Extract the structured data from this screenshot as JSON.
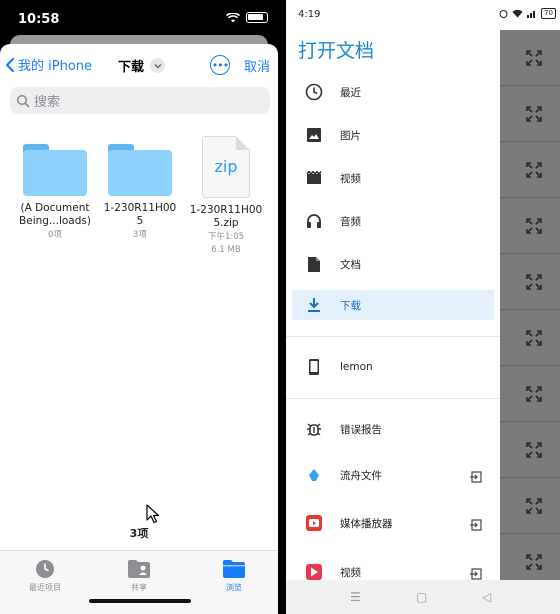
{
  "ios": {
    "status_time": "10:58",
    "nav": {
      "back_label": "我的 iPhone",
      "title": "下载",
      "cancel_label": "取消"
    },
    "search_placeholder": "搜索",
    "files": [
      {
        "type": "folder",
        "name_line1": "(A Document",
        "name_line2": "Being...loads)",
        "meta1": "0项",
        "meta2": ""
      },
      {
        "type": "folder",
        "name_line1": "1-230R11H00",
        "name_line2": "5",
        "meta1": "3项",
        "meta2": ""
      },
      {
        "type": "zip",
        "icon_text": "zip",
        "name_line1": "1-230R11H00",
        "name_line2": "5.zip",
        "meta1": "下午1:05",
        "meta2": "6.1 MB"
      }
    ],
    "item_count": "3项",
    "tabs": [
      {
        "label": "最近项目",
        "icon": "clock-icon"
      },
      {
        "label": "共享",
        "icon": "shared-folder-icon"
      },
      {
        "label": "浏览",
        "icon": "folder-icon"
      }
    ]
  },
  "android": {
    "status_time": "4:19",
    "battery": "70",
    "drawer_title": "打开文档",
    "items": [
      {
        "label": "最近",
        "icon": "clock-icon"
      },
      {
        "label": "图片",
        "icon": "image-icon"
      },
      {
        "label": "视频",
        "icon": "movie-icon"
      },
      {
        "label": "音频",
        "icon": "headphones-icon"
      },
      {
        "label": "文档",
        "icon": "document-icon"
      },
      {
        "label": "下载",
        "icon": "download-icon"
      }
    ],
    "device_label": "lemon",
    "bug_report_label": "错误报告",
    "apps": [
      {
        "label": "流舟文件",
        "icon": "liuzhou-app-icon"
      },
      {
        "label": "媒体播放器",
        "icon": "media-player-icon"
      },
      {
        "label": "视频",
        "icon": "video-app-icon"
      }
    ]
  }
}
